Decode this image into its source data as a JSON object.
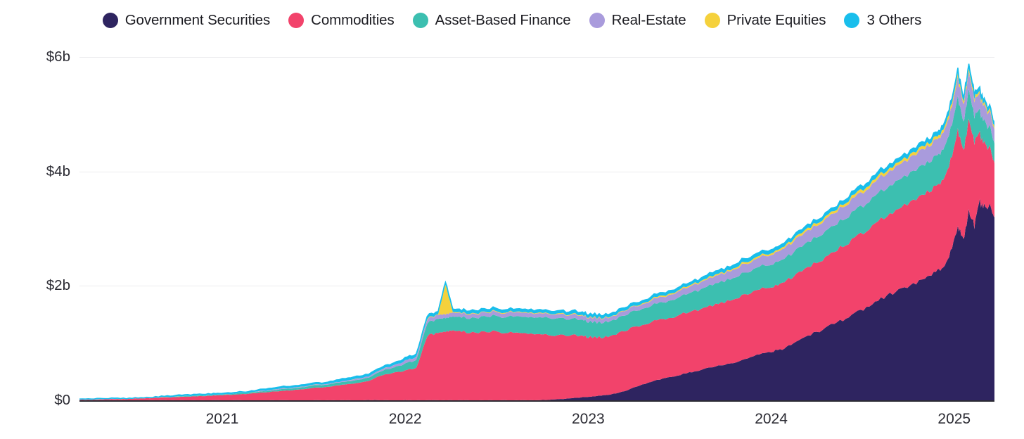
{
  "legend": {
    "items": [
      {
        "label": "Government Securities",
        "color": "#2E2460",
        "icon": "legend-dot-icon"
      },
      {
        "label": "Commodities",
        "color": "#F2436B",
        "icon": "legend-dot-icon"
      },
      {
        "label": "Asset-Based Finance",
        "color": "#3CBFB0",
        "icon": "legend-dot-icon"
      },
      {
        "label": "Real-Estate",
        "color": "#A99BDC",
        "icon": "legend-dot-icon"
      },
      {
        "label": "Private Equities",
        "color": "#F5D13C",
        "icon": "legend-dot-icon"
      },
      {
        "label": "3 Others",
        "color": "#19BEEC",
        "icon": "legend-dot-icon"
      }
    ]
  },
  "axes": {
    "y_ticks": [
      {
        "label": "$0",
        "value": 0
      },
      {
        "label": "$2b",
        "value": 2000000000
      },
      {
        "label": "$4b",
        "value": 4000000000
      },
      {
        "label": "$6b",
        "value": 6000000000
      }
    ],
    "x_ticks": [
      {
        "label": "2021",
        "value": 2021.0
      },
      {
        "label": "2022",
        "value": 2022.0
      },
      {
        "label": "2023",
        "value": 2023.0
      },
      {
        "label": "2024",
        "value": 2024.0
      },
      {
        "label": "2025",
        "value": 2025.0
      }
    ]
  },
  "chart_data": {
    "type": "area",
    "stacked": true,
    "title": "",
    "xlabel": "",
    "ylabel": "",
    "units": "USD billions",
    "xlim": [
      2020.22,
      2025.22
    ],
    "ylim": [
      0,
      6
    ],
    "grid": true,
    "legend_position": "top-center",
    "x_tick_labels": [
      "2021",
      "2022",
      "2023",
      "2024",
      "2025"
    ],
    "y_tick_labels": [
      "$0",
      "$2b",
      "$4b",
      "$6b"
    ],
    "x": [
      2020.22,
      2020.3,
      2020.38,
      2020.46,
      2020.54,
      2020.62,
      2020.7,
      2020.78,
      2020.86,
      2020.94,
      2021.0,
      2021.08,
      2021.16,
      2021.24,
      2021.32,
      2021.4,
      2021.48,
      2021.56,
      2021.64,
      2021.72,
      2021.8,
      2021.88,
      2021.94,
      2022.0,
      2022.06,
      2022.12,
      2022.18,
      2022.22,
      2022.26,
      2022.32,
      2022.4,
      2022.48,
      2022.56,
      2022.64,
      2022.72,
      2022.8,
      2022.88,
      2022.96,
      2023.0,
      2023.06,
      2023.12,
      2023.2,
      2023.28,
      2023.36,
      2023.44,
      2023.52,
      2023.6,
      2023.68,
      2023.76,
      2023.84,
      2023.92,
      2024.0,
      2024.06,
      2024.12,
      2024.2,
      2024.28,
      2024.36,
      2024.44,
      2024.52,
      2024.6,
      2024.68,
      2024.76,
      2024.84,
      2024.9,
      2024.94,
      2024.98,
      2025.02,
      2025.05,
      2025.08,
      2025.11,
      2025.14,
      2025.17,
      2025.2,
      2025.22
    ],
    "series": [
      {
        "name": "Government Securities",
        "color": "#2E2460",
        "values": [
          0.0,
          0.0,
          0.0,
          0.0,
          0.0,
          0.0,
          0.0,
          0.0,
          0.0,
          0.0,
          0.0,
          0.0,
          0.0,
          0.0,
          0.0,
          0.0,
          0.0,
          0.0,
          0.0,
          0.0,
          0.0,
          0.0,
          0.0,
          0.0,
          0.0,
          0.0,
          0.0,
          0.0,
          0.0,
          0.0,
          0.0,
          0.0,
          0.0,
          0.0,
          0.0,
          0.01,
          0.03,
          0.05,
          0.06,
          0.08,
          0.1,
          0.16,
          0.26,
          0.34,
          0.4,
          0.46,
          0.52,
          0.58,
          0.63,
          0.7,
          0.78,
          0.85,
          0.9,
          0.98,
          1.12,
          1.24,
          1.36,
          1.48,
          1.62,
          1.78,
          1.9,
          2.0,
          2.12,
          2.22,
          2.34,
          2.6,
          3.05,
          2.8,
          3.3,
          3.05,
          3.45,
          3.35,
          3.4,
          3.2
        ]
      },
      {
        "name": "Commodities",
        "color": "#F2436B",
        "values": [
          0.01,
          0.01,
          0.02,
          0.02,
          0.03,
          0.04,
          0.05,
          0.06,
          0.07,
          0.08,
          0.09,
          0.1,
          0.12,
          0.14,
          0.16,
          0.18,
          0.21,
          0.23,
          0.26,
          0.29,
          0.33,
          0.45,
          0.48,
          0.52,
          0.56,
          1.12,
          1.18,
          1.2,
          1.22,
          1.2,
          1.18,
          1.2,
          1.18,
          1.16,
          1.14,
          1.13,
          1.1,
          1.08,
          1.05,
          1.02,
          1.02,
          1.05,
          1.05,
          1.04,
          1.04,
          1.05,
          1.06,
          1.08,
          1.1,
          1.12,
          1.12,
          1.14,
          1.15,
          1.16,
          1.2,
          1.22,
          1.26,
          1.3,
          1.34,
          1.38,
          1.42,
          1.46,
          1.48,
          1.5,
          1.52,
          1.58,
          1.7,
          1.55,
          1.6,
          1.45,
          1.2,
          1.1,
          1.0,
          0.95
        ]
      },
      {
        "name": "Asset-Based Finance",
        "color": "#3CBFB0",
        "values": [
          0.0,
          0.0,
          0.0,
          0.0,
          0.0,
          0.0,
          0.0,
          0.01,
          0.01,
          0.01,
          0.01,
          0.02,
          0.02,
          0.02,
          0.03,
          0.03,
          0.04,
          0.04,
          0.05,
          0.05,
          0.06,
          0.08,
          0.09,
          0.12,
          0.14,
          0.22,
          0.24,
          0.24,
          0.24,
          0.25,
          0.26,
          0.27,
          0.28,
          0.29,
          0.29,
          0.3,
          0.29,
          0.28,
          0.27,
          0.26,
          0.26,
          0.27,
          0.28,
          0.29,
          0.3,
          0.32,
          0.34,
          0.36,
          0.37,
          0.38,
          0.39,
          0.4,
          0.41,
          0.42,
          0.44,
          0.45,
          0.46,
          0.47,
          0.48,
          0.49,
          0.5,
          0.51,
          0.52,
          0.52,
          0.53,
          0.55,
          0.58,
          0.5,
          0.52,
          0.45,
          0.4,
          0.38,
          0.36,
          0.34
        ]
      },
      {
        "name": "Real-Estate",
        "color": "#A99BDC",
        "values": [
          0.0,
          0.0,
          0.0,
          0.0,
          0.0,
          0.0,
          0.0,
          0.0,
          0.0,
          0.0,
          0.0,
          0.0,
          0.0,
          0.01,
          0.01,
          0.01,
          0.01,
          0.01,
          0.01,
          0.02,
          0.02,
          0.03,
          0.04,
          0.05,
          0.05,
          0.07,
          0.07,
          0.07,
          0.07,
          0.07,
          0.07,
          0.07,
          0.07,
          0.07,
          0.07,
          0.07,
          0.07,
          0.07,
          0.07,
          0.07,
          0.07,
          0.08,
          0.08,
          0.09,
          0.1,
          0.11,
          0.12,
          0.13,
          0.14,
          0.15,
          0.16,
          0.17,
          0.18,
          0.19,
          0.2,
          0.21,
          0.22,
          0.23,
          0.24,
          0.25,
          0.26,
          0.27,
          0.28,
          0.28,
          0.29,
          0.31,
          0.33,
          0.3,
          0.31,
          0.28,
          0.27,
          0.26,
          0.25,
          0.24
        ]
      },
      {
        "name": "Private Equities",
        "color": "#F5D13C",
        "values": [
          0.0,
          0.0,
          0.0,
          0.0,
          0.0,
          0.0,
          0.0,
          0.0,
          0.0,
          0.0,
          0.0,
          0.0,
          0.0,
          0.0,
          0.0,
          0.0,
          0.0,
          0.0,
          0.0,
          0.0,
          0.0,
          0.0,
          0.0,
          0.0,
          0.0,
          0.01,
          0.01,
          0.52,
          0.01,
          0.01,
          0.01,
          0.01,
          0.01,
          0.01,
          0.01,
          0.01,
          0.01,
          0.01,
          0.01,
          0.01,
          0.01,
          0.01,
          0.01,
          0.02,
          0.02,
          0.02,
          0.02,
          0.02,
          0.02,
          0.03,
          0.03,
          0.03,
          0.03,
          0.04,
          0.04,
          0.04,
          0.04,
          0.05,
          0.05,
          0.05,
          0.05,
          0.05,
          0.05,
          0.05,
          0.05,
          0.06,
          0.06,
          0.05,
          0.05,
          0.05,
          0.04,
          0.04,
          0.04,
          0.04
        ]
      },
      {
        "name": "3 Others",
        "color": "#19BEEC",
        "values": [
          0.01,
          0.01,
          0.01,
          0.01,
          0.01,
          0.01,
          0.02,
          0.02,
          0.02,
          0.02,
          0.02,
          0.02,
          0.02,
          0.03,
          0.03,
          0.03,
          0.03,
          0.03,
          0.04,
          0.04,
          0.04,
          0.04,
          0.04,
          0.05,
          0.05,
          0.05,
          0.05,
          0.05,
          0.05,
          0.05,
          0.05,
          0.05,
          0.05,
          0.05,
          0.05,
          0.05,
          0.05,
          0.05,
          0.05,
          0.05,
          0.05,
          0.05,
          0.05,
          0.05,
          0.05,
          0.05,
          0.05,
          0.06,
          0.06,
          0.06,
          0.06,
          0.06,
          0.06,
          0.06,
          0.06,
          0.06,
          0.06,
          0.07,
          0.07,
          0.07,
          0.07,
          0.07,
          0.07,
          0.07,
          0.08,
          0.08,
          0.09,
          0.08,
          0.08,
          0.07,
          0.07,
          0.06,
          0.06,
          0.06
        ]
      }
    ]
  }
}
